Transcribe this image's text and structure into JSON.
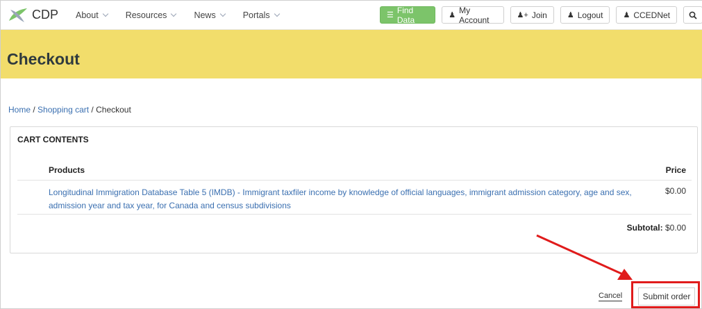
{
  "nav": {
    "logo_text": "CDP",
    "menu": [
      {
        "label": "About"
      },
      {
        "label": "Resources"
      },
      {
        "label": "News"
      },
      {
        "label": "Portals"
      }
    ],
    "find_data": "Find Data",
    "my_account": "My Account",
    "join": "Join",
    "logout": "Logout",
    "ccednet": "CCEDNet"
  },
  "page": {
    "title": "Checkout"
  },
  "breadcrumb": {
    "home": "Home",
    "sep1": " / ",
    "cart": "Shopping cart",
    "sep2": " / ",
    "current": "Checkout"
  },
  "cart": {
    "title": "CART CONTENTS",
    "col_products": "Products",
    "col_price": "Price",
    "items": [
      {
        "name": "Longitudinal Immigration Database Table 5 (IMDB) - Immigrant taxfiler income by knowledge of official languages, immigrant admission category, age and sex, admission year and tax year, for Canada and census subdivisions",
        "price": "$0.00"
      }
    ],
    "subtotal_label": "Subtotal:",
    "subtotal_value": " $0.00"
  },
  "actions": {
    "cancel": "Cancel",
    "submit": "Submit order"
  },
  "colors": {
    "banner": "#f2dd6b",
    "find_data": "#7cc46a",
    "link": "#3a6fb0",
    "highlight": "#e01b1b"
  }
}
